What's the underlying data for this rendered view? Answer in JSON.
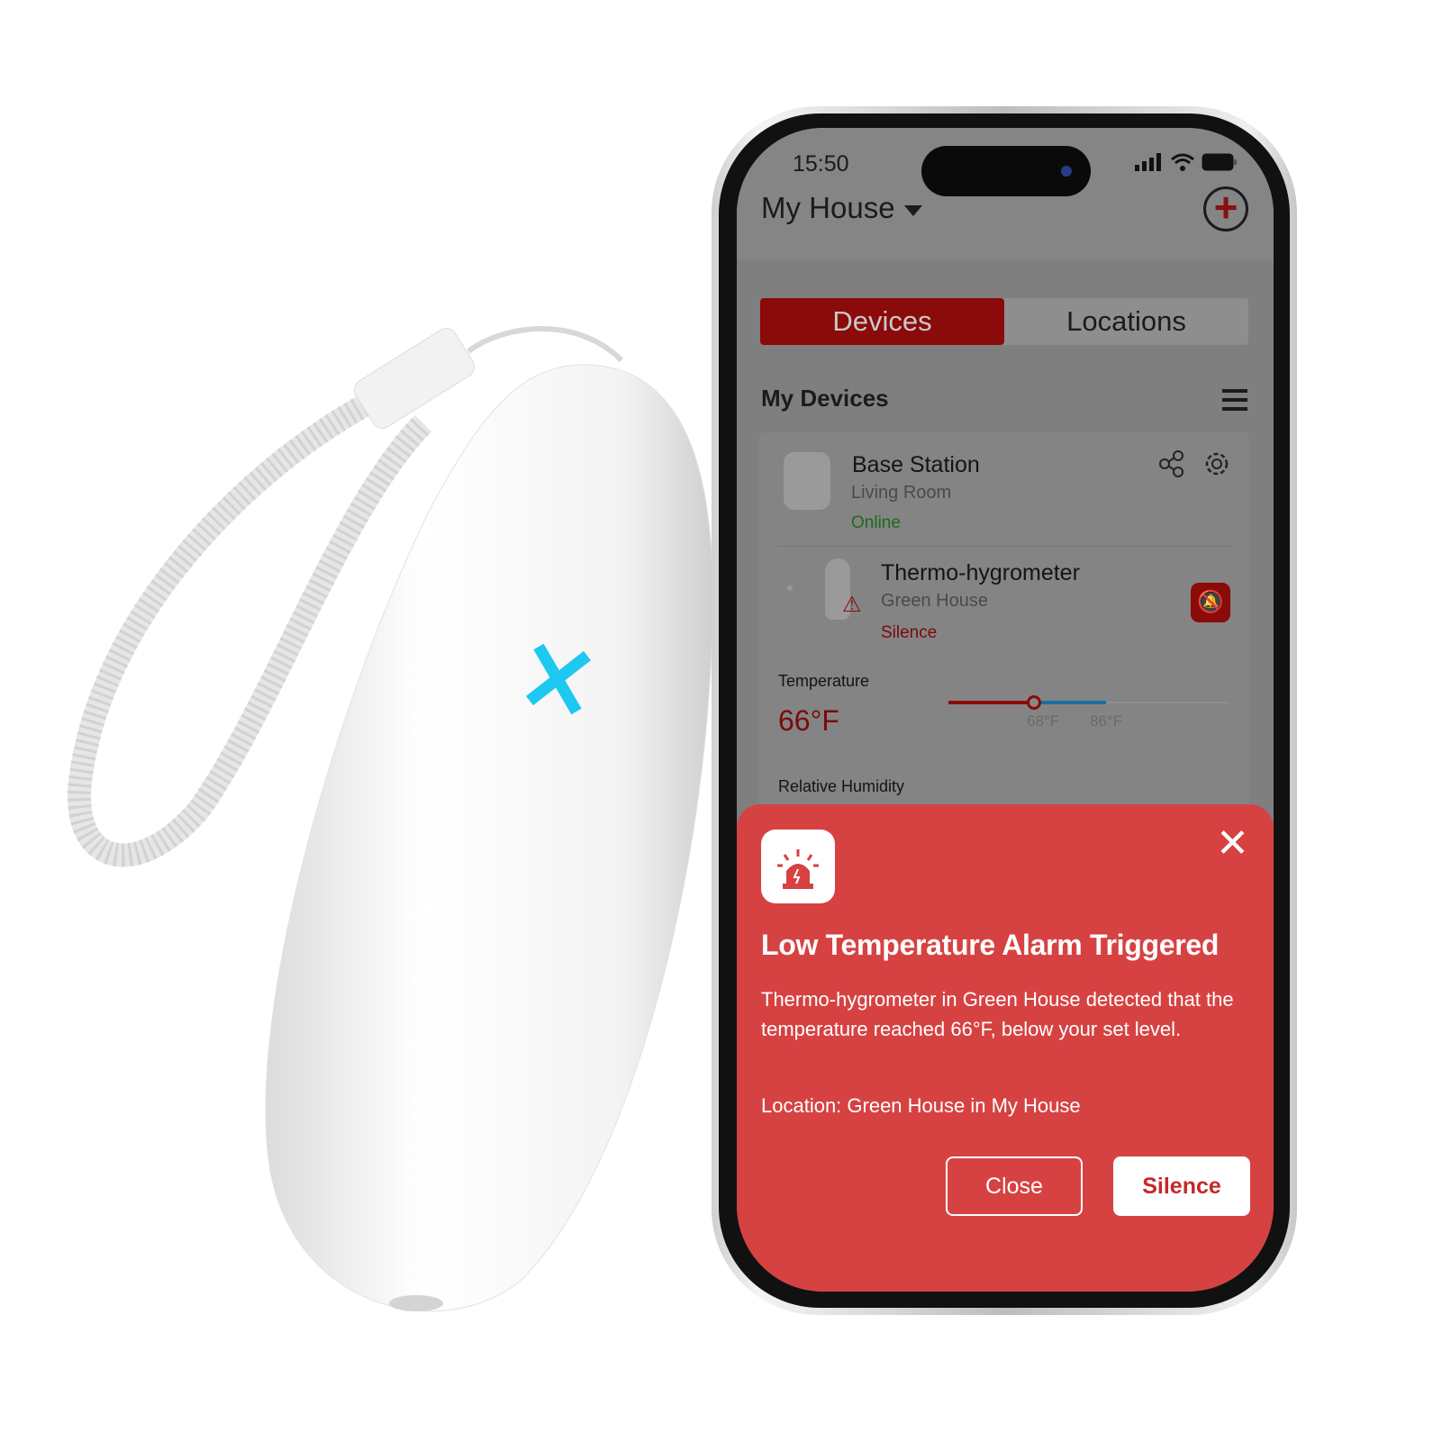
{
  "status_bar": {
    "time": "15:50",
    "icons": [
      "signal-icon",
      "wifi-icon",
      "battery-icon"
    ]
  },
  "header": {
    "title": "My House",
    "add_icon": "plus-circle-icon"
  },
  "tabs": [
    {
      "label": "Devices",
      "active": true
    },
    {
      "label": "Locations",
      "active": false
    }
  ],
  "section": {
    "title": "My Devices",
    "menu_icon": "hamburger-icon"
  },
  "devices": [
    {
      "name": "Base Station",
      "location": "Living Room",
      "status": "Online"
    },
    {
      "name": "Thermo-hygrometer",
      "location": "Green House",
      "status": "Silence"
    }
  ],
  "temperature": {
    "label": "Temperature",
    "value": "66°F",
    "low_threshold": "68°F",
    "high_threshold": "86°F"
  },
  "humidity": {
    "label": "Relative Humidity"
  },
  "alert": {
    "title": "Low Temperature Alarm Triggered",
    "body": "Thermo-hygrometer in Green House detected that the temperature reached 66°F, below your set level.",
    "location": "Location: Green House in My House",
    "close_label": "Close",
    "silence_label": "Silence"
  },
  "colors": {
    "accent": "#8b0a0a",
    "alert_bg": "#d64242",
    "online": "#1c6b1c",
    "logo": "#1ec8f0"
  }
}
